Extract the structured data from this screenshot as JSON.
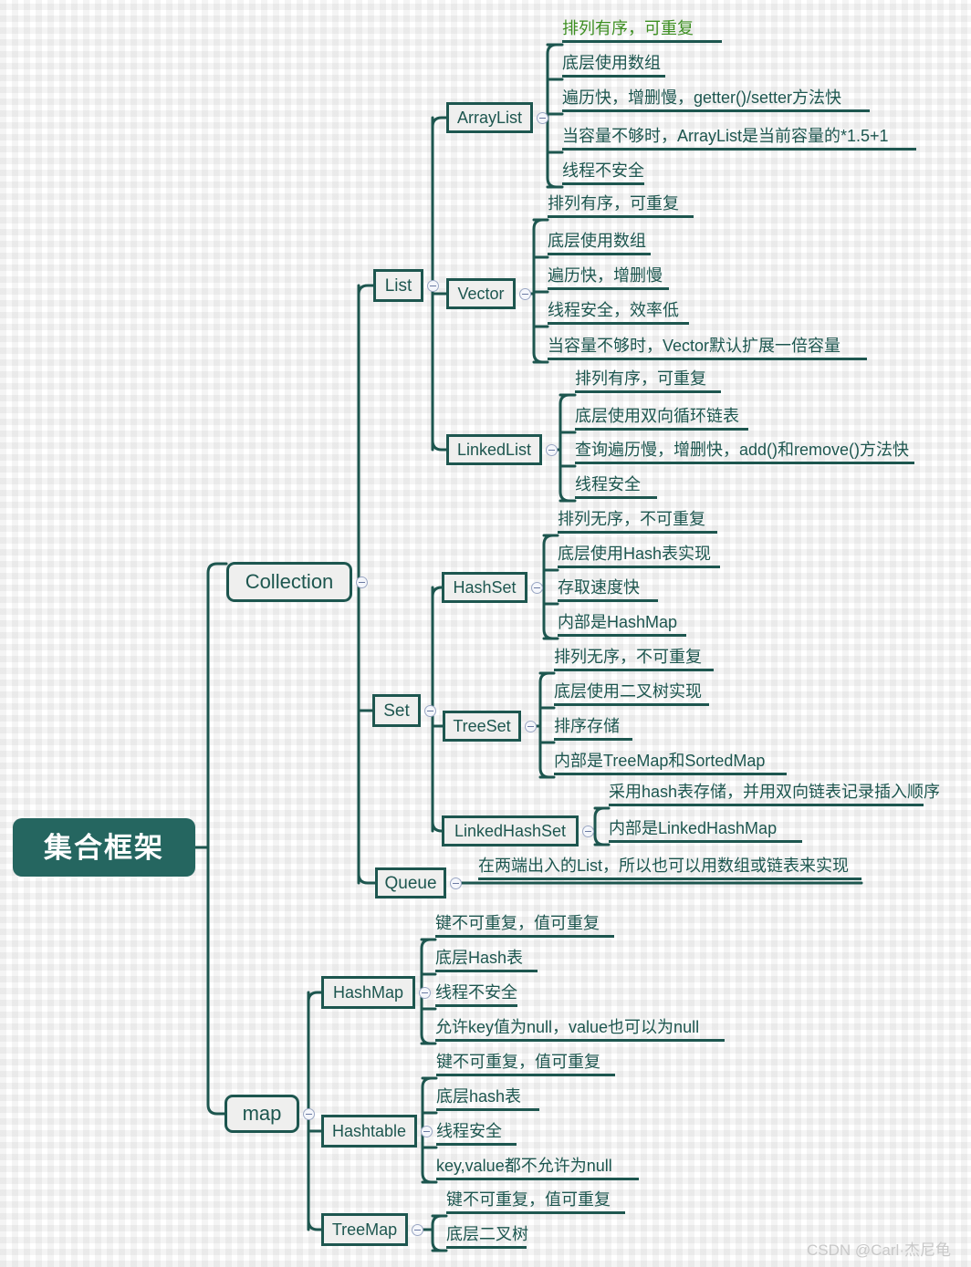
{
  "title": "集合框架",
  "colors": {
    "line": "#1d564f",
    "node_fill": "#efefee",
    "root_fill": "#256660",
    "root_text": "#ffffff",
    "highlight_text": "#3d8f22",
    "watermark": "#c9c9c9"
  },
  "watermark": "CSDN @Carl·杰尼龟",
  "root": {
    "label": "集合框架"
  },
  "branches": [
    {
      "label": "Collection",
      "children": [
        {
          "label": "List",
          "children": [
            {
              "label": "ArrayList",
              "leaves": [
                {
                  "text": "排列有序，可重复",
                  "highlight": true
                },
                {
                  "text": "底层使用数组",
                  "highlight": false
                },
                {
                  "text": "遍历快，增删慢，getter()/setter方法快",
                  "highlight": false
                },
                {
                  "text": "当容量不够时，ArrayList是当前容量的*1.5+1",
                  "highlight": false
                },
                {
                  "text": "线程不安全",
                  "highlight": false
                }
              ]
            },
            {
              "label": "Vector",
              "leaves": [
                {
                  "text": "排列有序，可重复",
                  "highlight": false
                },
                {
                  "text": "底层使用数组",
                  "highlight": false
                },
                {
                  "text": "遍历快，增删慢",
                  "highlight": false
                },
                {
                  "text": "线程安全，效率低",
                  "highlight": false
                },
                {
                  "text": "当容量不够时，Vector默认扩展一倍容量",
                  "highlight": false
                }
              ]
            },
            {
              "label": "LinkedList",
              "leaves": [
                {
                  "text": "排列有序，可重复",
                  "highlight": false
                },
                {
                  "text": "底层使用双向循环链表",
                  "highlight": false
                },
                {
                  "text": "查询遍历慢，增删快，add()和remove()方法快",
                  "highlight": false
                },
                {
                  "text": "线程安全",
                  "highlight": false
                }
              ]
            }
          ]
        },
        {
          "label": "Set",
          "children": [
            {
              "label": "HashSet",
              "leaves": [
                {
                  "text": "排列无序，不可重复",
                  "highlight": false
                },
                {
                  "text": "底层使用Hash表实现",
                  "highlight": false
                },
                {
                  "text": "存取速度快",
                  "highlight": false
                },
                {
                  "text": "内部是HashMap",
                  "highlight": false
                }
              ]
            },
            {
              "label": "TreeSet",
              "leaves": [
                {
                  "text": "排列无序，不可重复",
                  "highlight": false
                },
                {
                  "text": "底层使用二叉树实现",
                  "highlight": false
                },
                {
                  "text": "排序存储",
                  "highlight": false
                },
                {
                  "text": "内部是TreeMap和SortedMap",
                  "highlight": false
                }
              ]
            },
            {
              "label": "LinkedHashSet",
              "leaves": [
                {
                  "text": "采用hash表存储，并用双向链表记录插入顺序",
                  "highlight": false
                },
                {
                  "text": "内部是LinkedHashMap",
                  "highlight": false
                }
              ]
            }
          ]
        },
        {
          "label": "Queue",
          "leaves": [
            {
              "text": "在两端出入的List，所以也可以用数组或链表来实现",
              "highlight": false
            }
          ]
        }
      ]
    },
    {
      "label": "map",
      "children": [
        {
          "label": "HashMap",
          "leaves": [
            {
              "text": "键不可重复，值可重复",
              "highlight": false
            },
            {
              "text": "底层Hash表",
              "highlight": false
            },
            {
              "text": "线程不安全",
              "highlight": false
            },
            {
              "text": "允许key值为null，value也可以为null",
              "highlight": false
            }
          ]
        },
        {
          "label": "Hashtable",
          "leaves": [
            {
              "text": "键不可重复，值可重复",
              "highlight": false
            },
            {
              "text": "底层hash表",
              "highlight": false
            },
            {
              "text": "线程安全",
              "highlight": false
            },
            {
              "text": "key,value都不允许为null",
              "highlight": false
            }
          ]
        },
        {
          "label": "TreeMap",
          "leaves": [
            {
              "text": "键不可重复，值可重复",
              "highlight": false
            },
            {
              "text": "底层二叉树",
              "highlight": false
            }
          ]
        }
      ]
    }
  ]
}
